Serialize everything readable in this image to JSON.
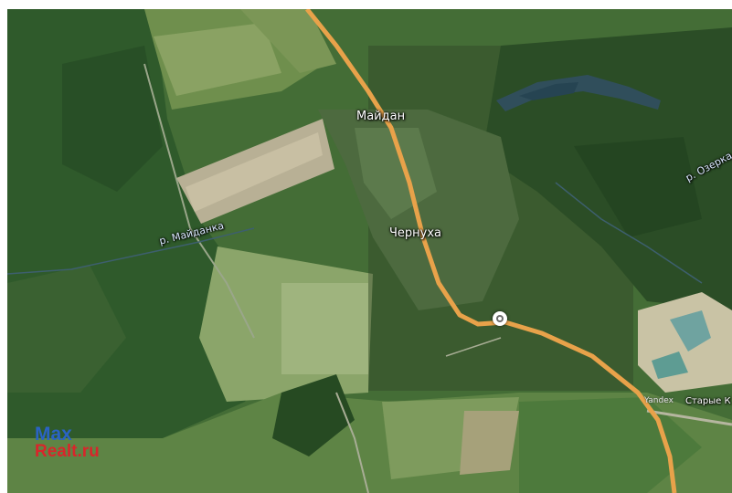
{
  "map": {
    "type": "satellite",
    "places": {
      "maidan": "Майдан",
      "chernukha": "Чернуха",
      "starye": "Старые К"
    },
    "rivers": {
      "maidanka": "р. Майданка",
      "ozerka": "р. Озерка"
    },
    "provider": "Yandex",
    "colors": {
      "road": "#e8a24a",
      "forest": "#2f5a2b",
      "field": "#8fa366",
      "water": "#3d5f6e"
    }
  },
  "marker": {
    "icon": "location-pin-icon"
  },
  "brand": {
    "line1": "Max",
    "line2": "Realt.ru"
  }
}
